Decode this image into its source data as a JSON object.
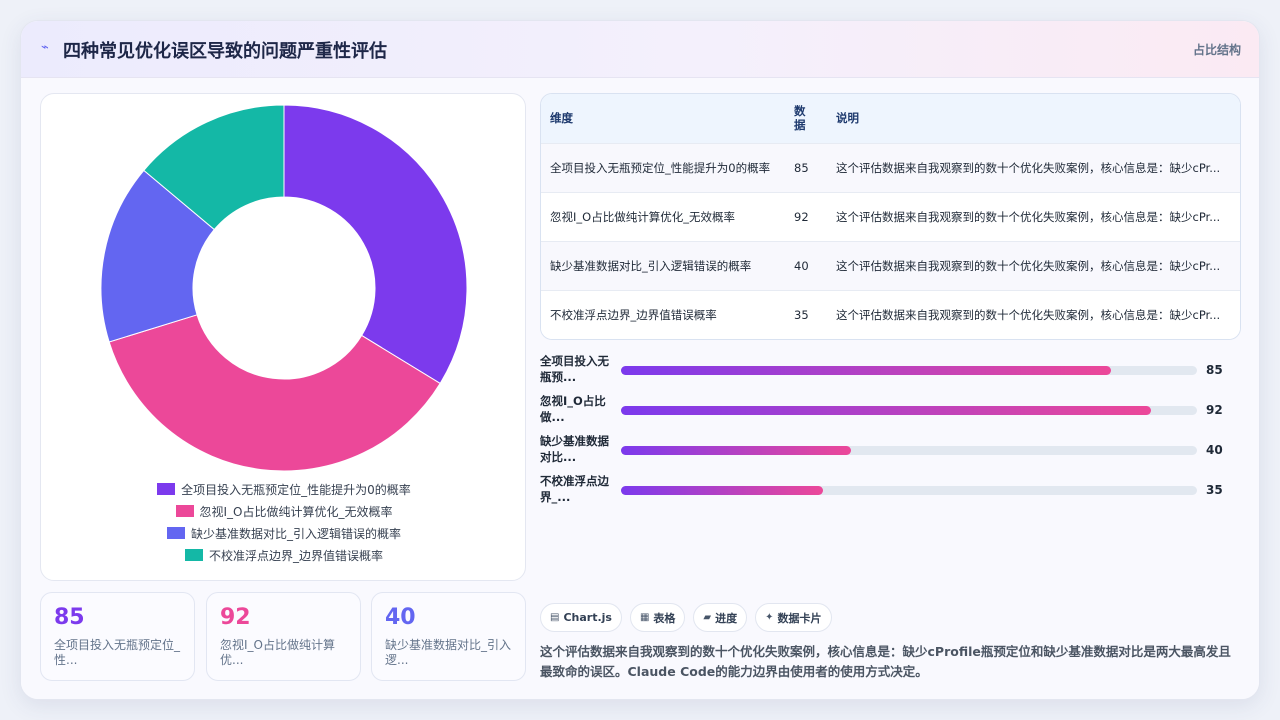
{
  "header": {
    "icon": "chart-line-icon",
    "title": "四种常见优化误区导致的问题严重性评估",
    "tag": "占比结构"
  },
  "chart_data": {
    "type": "pie",
    "categories": [
      "全项目投入无瓶预定位_性能提升为0的概率",
      "忽视I_O占比做纯计算优化_无效概率",
      "缺少基准数据对比_引入逻辑错误的概率",
      "不校准浮点边界_边界值错误概率"
    ],
    "values": [
      85,
      92,
      40,
      35
    ],
    "colors": [
      "#7c3aed",
      "#ec4899",
      "#6366f1",
      "#14b8a6"
    ],
    "legend_position": "bottom"
  },
  "stats": [
    {
      "value": "85",
      "label": "全项目投入无瓶预定位_性...",
      "color": "#7c3aed"
    },
    {
      "value": "92",
      "label": "忽视I_O占比做纯计算优...",
      "color": "#ec4899"
    },
    {
      "value": "40",
      "label": "缺少基准数据对比_引入逻...",
      "color": "#6366f1"
    }
  ],
  "table": {
    "headers": [
      "维度",
      "数据",
      "说明"
    ],
    "rows": [
      {
        "dim": "全项目投入无瓶预定位_性能提升为0的概率",
        "val": "85",
        "desc": "这个评估数据来自我观察到的数十个优化失败案例，核心信息是：缺少cPr..."
      },
      {
        "dim": "忽视I_O占比做纯计算优化_无效概率",
        "val": "92",
        "desc": "这个评估数据来自我观察到的数十个优化失败案例，核心信息是：缺少cPr..."
      },
      {
        "dim": "缺少基准数据对比_引入逻辑错误的概率",
        "val": "40",
        "desc": "这个评估数据来自我观察到的数十个优化失败案例，核心信息是：缺少cPr..."
      },
      {
        "dim": "不校准浮点边界_边界值错误概率",
        "val": "35",
        "desc": "这个评估数据来自我观察到的数十个优化失败案例，核心信息是：缺少cPr..."
      }
    ]
  },
  "bars": {
    "max": 100,
    "items": [
      {
        "label": "全项目投入无瓶预...",
        "value": 85
      },
      {
        "label": "忽视I_O占比做...",
        "value": 92
      },
      {
        "label": "缺少基准数据对比...",
        "value": 40
      },
      {
        "label": "不校准浮点边界_...",
        "value": 35
      }
    ]
  },
  "chips": [
    {
      "icon": "chart-icon",
      "glyph": "▤",
      "label": "Chart.js"
    },
    {
      "icon": "table-icon",
      "glyph": "▦",
      "label": "表格"
    },
    {
      "icon": "progress-icon",
      "glyph": "▰",
      "label": "进度"
    },
    {
      "icon": "sparkle-icon",
      "glyph": "✦",
      "label": "数据卡片"
    }
  ],
  "summary": "这个评估数据来自我观察到的数十个优化失败案例，核心信息是：缺少cProfile瓶预定位和缺少基准数据对比是两大最高发且最致命的误区。Claude Code的能力边界由使用者的使用方式决定。"
}
